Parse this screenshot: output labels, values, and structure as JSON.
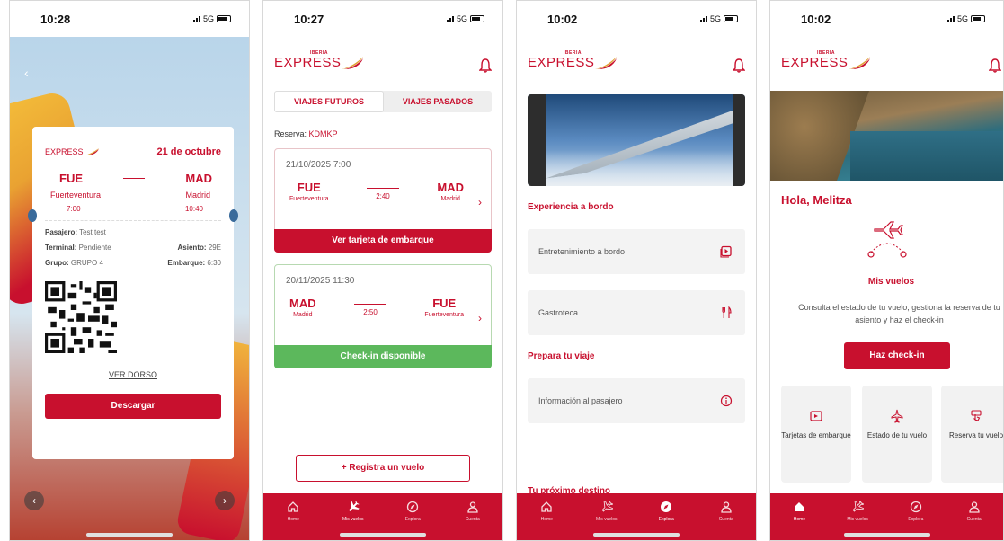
{
  "brand": {
    "logo_small": "IBERIA",
    "logo_text": "EXPRESS",
    "color": "#c8102e"
  },
  "panel1": {
    "time": "10:28",
    "network": "5G",
    "date": "21 de octubre",
    "origin_code": "FUE",
    "dest_code": "MAD",
    "origin_city": "Fuerteventura",
    "dest_city": "Madrid",
    "dep_time": "7:00",
    "arr_time": "10:40",
    "passenger_label": "Pasajero:",
    "passenger": "Test test",
    "terminal_label": "Terminal:",
    "terminal": "Pendiente",
    "seat_label": "Asiento:",
    "seat": "29E",
    "group_label": "Grupo:",
    "group": "GRUPO 4",
    "boarding_label": "Embarque:",
    "boarding": "6:30",
    "ver_dorso": "VER DORSO",
    "download": "Descargar"
  },
  "panel2": {
    "time": "10:27",
    "network": "5G",
    "tab_future": "VIAJES FUTUROS",
    "tab_past": "VIAJES PASADOS",
    "reserva_label": "Reserva:",
    "reserva_code": "KDMKP",
    "flights": [
      {
        "datetime": "21/10/2025 7:00",
        "from": "FUE",
        "from_city": "Fuerteventura",
        "duration": "2:40",
        "to": "MAD",
        "to_city": "Madrid",
        "action": "Ver tarjeta de embarque"
      },
      {
        "datetime": "20/11/2025 11:30",
        "from": "MAD",
        "from_city": "Madrid",
        "duration": "2:50",
        "to": "FUE",
        "to_city": "Fuerteventura",
        "action": "Check-in disponible"
      }
    ],
    "register": "+ Registra un vuelo"
  },
  "panel3": {
    "time": "10:02",
    "network": "5G",
    "sec_experiencia": "Experiencia a bordo",
    "entretenimiento": "Entretenimiento a bordo",
    "gastroteca": "Gastroteca",
    "sec_prepara": "Prepara tu viaje",
    "info_pasajero": "Información al pasajero",
    "sec_destino": "Tu próximo destino"
  },
  "panel4": {
    "time": "10:02",
    "network": "5G",
    "greeting": "Hola, Melitza",
    "mis_vuelos": "Mis vuelos",
    "description": "Consulta el estado de tu vuelo, gestiona la reserva de tu asiento y haz el check-in",
    "checkin": "Haz check-in",
    "tiles": [
      "Tarjetas de embarque",
      "Estado de tu vuelo",
      "Reserva tu vuelo"
    ]
  },
  "tabbar": {
    "home": "Home",
    "mis_vuelos": "Mis vuelos",
    "explora": "Explora",
    "cuenta": "Cuenta"
  }
}
